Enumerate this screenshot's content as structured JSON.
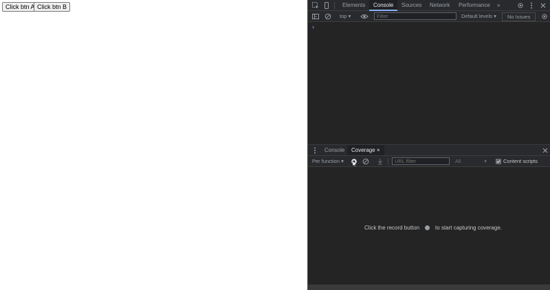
{
  "page": {
    "buttons": [
      {
        "label": "Click btn A"
      },
      {
        "label": "Click btn B"
      }
    ]
  },
  "devtools": {
    "tabs": [
      "Elements",
      "Console",
      "Sources",
      "Network",
      "Performance"
    ],
    "more_tabs": "»",
    "console_toolbar": {
      "context": "top",
      "filter_placeholder": "Filter",
      "levels": "Default levels",
      "issues": "No Issues"
    },
    "prompt": "›",
    "drawer": {
      "tabs": [
        "Console",
        "Coverage"
      ],
      "close_label": "×",
      "coverage_toolbar": {
        "mode": "Per function",
        "url_filter_placeholder": "URL filter",
        "type": "All",
        "content_scripts": "Content scripts"
      },
      "empty_before": "Click the record button",
      "empty_after": "to start capturing coverage."
    },
    "colors": {
      "accent": "#8ab4f8",
      "panel": "#242424",
      "toolbar": "#292a2d"
    }
  }
}
